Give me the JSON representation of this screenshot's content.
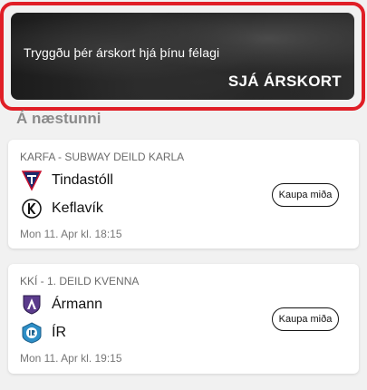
{
  "banner": {
    "text": "Tryggðu þér árskort hjá þínu félagi",
    "cta": "SJÁ ÁRSKORT"
  },
  "section_title": "Á næstunni",
  "games": [
    {
      "league": "KARFA - SUBWAY DEILD KARLA",
      "home": "Tindastóll",
      "away": "Keflavík",
      "date": "Mon 11. Apr kl. 18:15",
      "button": "Kaupa miða"
    },
    {
      "league": "KKÍ - 1. DEILD KVENNA",
      "home": "Ármann",
      "away": "ÍR",
      "date": "Mon 11. Apr kl. 19:15",
      "button": "Kaupa miða"
    }
  ],
  "colors": {
    "highlight_border": "#e01e26",
    "background": "#f1f1f1"
  },
  "icons": {
    "tindastoll": "tindastoll-logo-icon",
    "keflavik": "keflavik-logo-icon",
    "armann": "armann-logo-icon",
    "ir": "ir-logo-icon"
  }
}
